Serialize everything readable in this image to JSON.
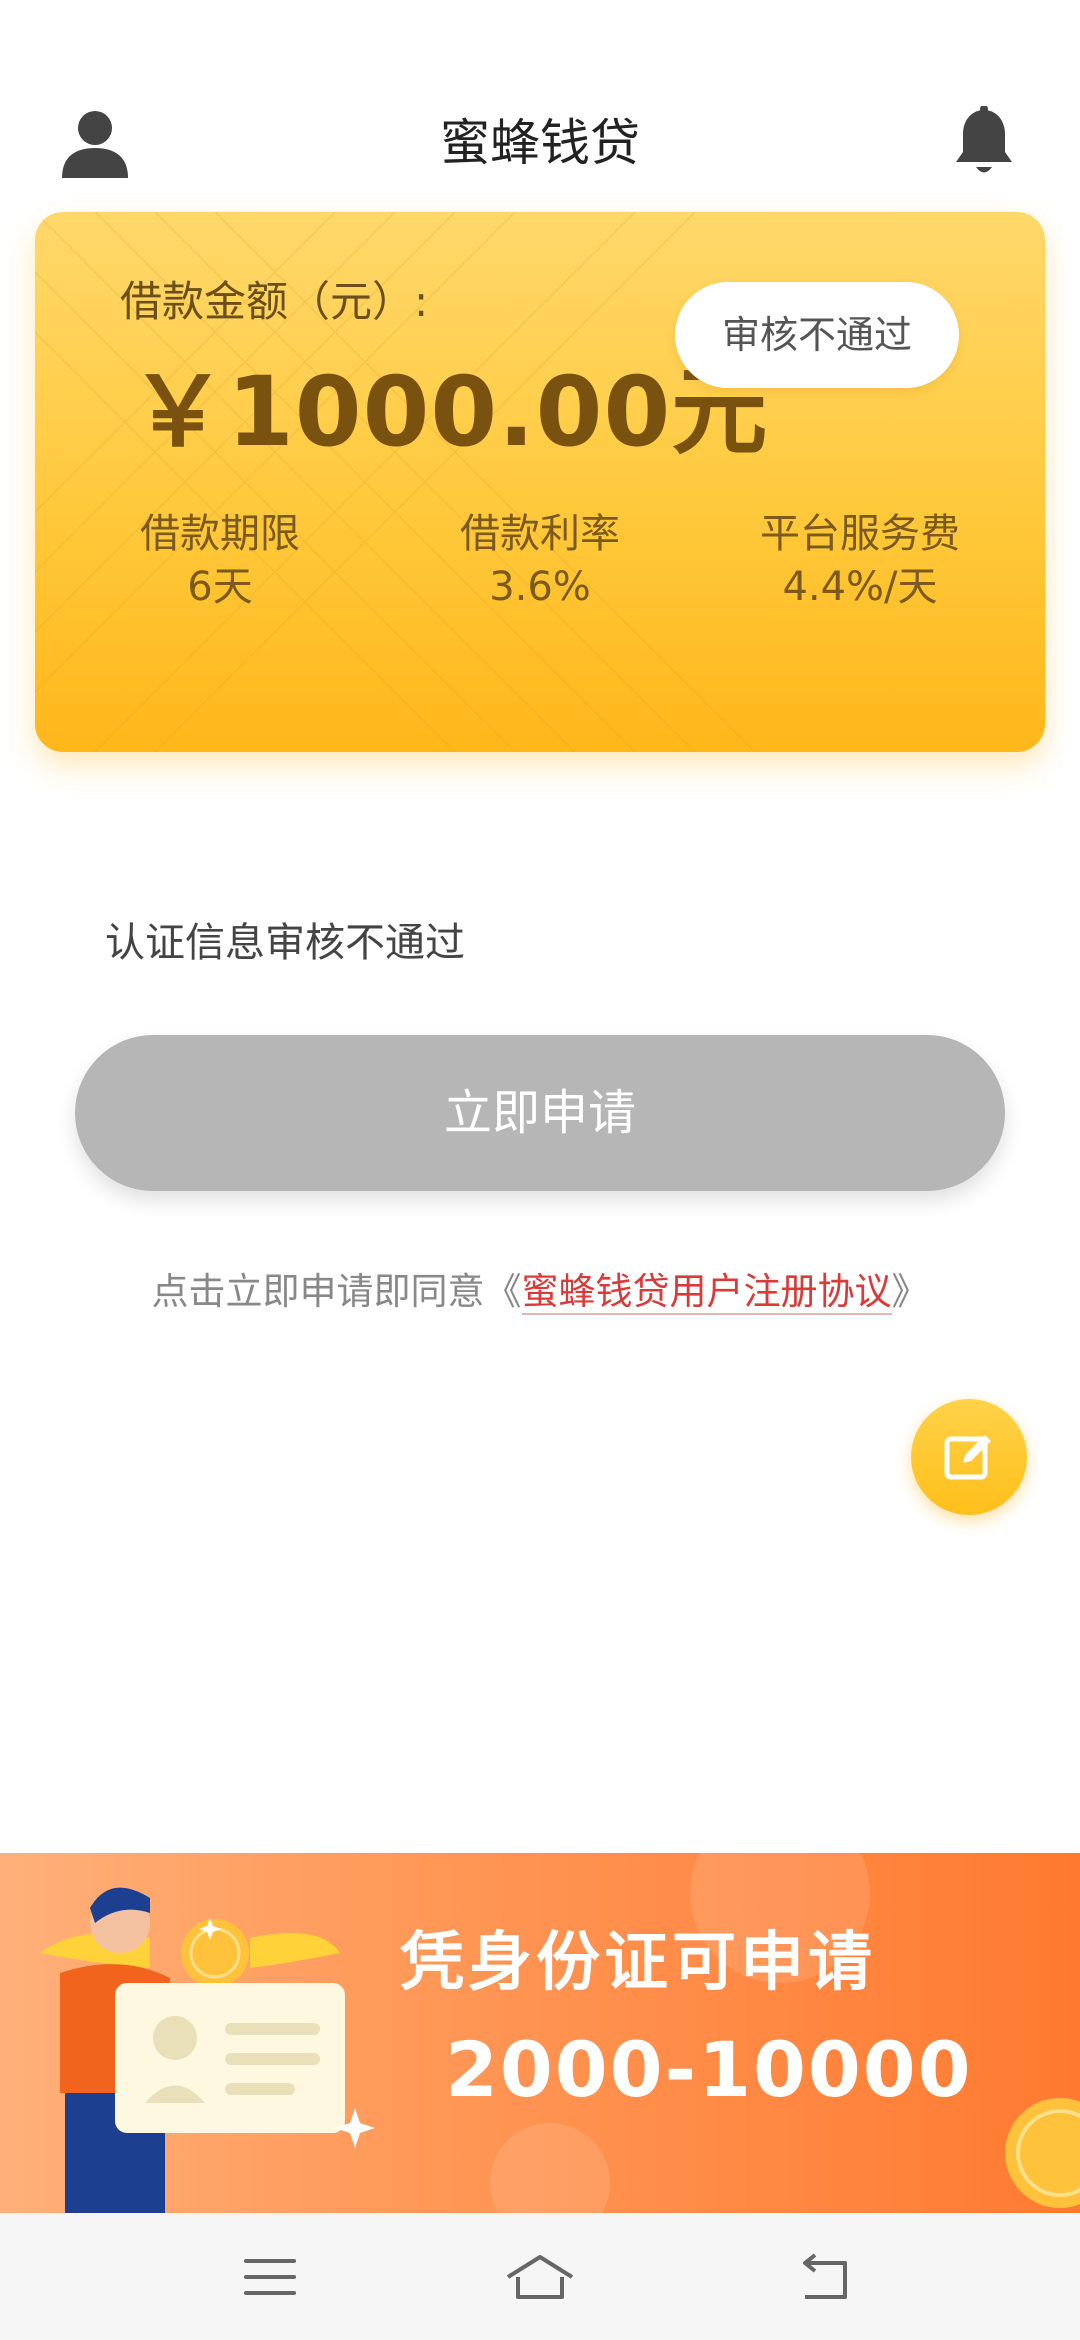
{
  "header": {
    "title": "蜜蜂钱贷",
    "profile_icon": "user-icon",
    "bell_icon": "bell-icon"
  },
  "card": {
    "amount_label": "借款金额（元）:",
    "amount_value": "￥1000.00元",
    "status": "审核不通过",
    "stats": [
      {
        "label": "借款期限",
        "value": "6天"
      },
      {
        "label": "借款利率",
        "value": "3.6%"
      },
      {
        "label": "平台服务费",
        "value": "4.4%/天"
      }
    ],
    "colors": {
      "gradient_top": "#ffd86b",
      "gradient_bottom": "#ffb71a"
    }
  },
  "notice": "认证信息审核不通过",
  "apply_button": "立即申请",
  "agreement": {
    "prefix": "点击立即申请即同意《",
    "link": "蜜蜂钱贷用户注册协议",
    "suffix": "》"
  },
  "fab_icon": "edit-icon",
  "banner": {
    "title": "凭身份证可申请",
    "range": "2000-10000"
  },
  "navbar": {
    "menu_icon": "menu-icon",
    "home_icon": "home-icon",
    "back_icon": "back-icon"
  }
}
